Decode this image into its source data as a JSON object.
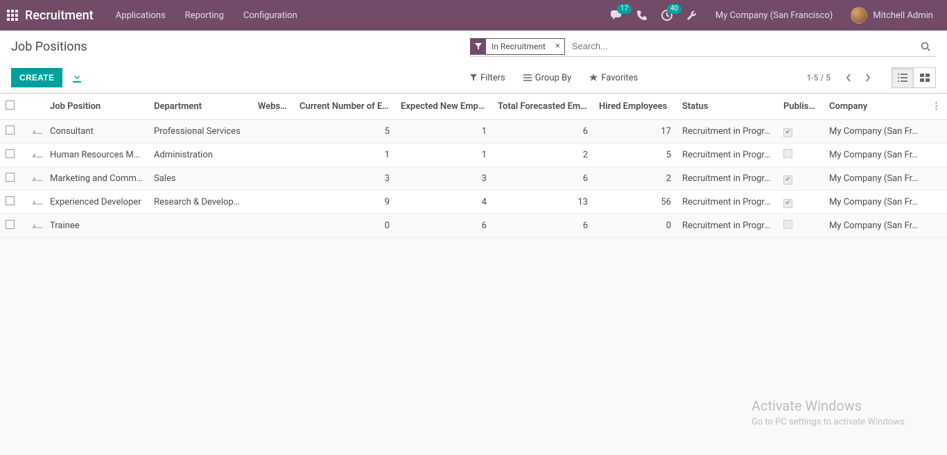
{
  "brand": "Recruitment",
  "nav": {
    "applications": "Applications",
    "reporting": "Reporting",
    "configuration": "Configuration"
  },
  "badges": {
    "chat": "17",
    "clock": "40"
  },
  "company": "My Company (San Francisco)",
  "user": "Mitchell Admin",
  "breadcrumb": "Job Positions",
  "search": {
    "facet_label": "In Recruitment",
    "placeholder": "Search..."
  },
  "opts": {
    "filters": "Filters",
    "groupby": "Group By",
    "favorites": "Favorites"
  },
  "create": "CREATE",
  "pager": "1-5 / 5",
  "cols": {
    "job": "Job Position",
    "dept": "Department",
    "website": "Website",
    "current": "Current Number of E…",
    "expected": "Expected New Empl…",
    "forecast": "Total Forecasted Em…",
    "hired": "Hired Employees",
    "status": "Status",
    "published": "Published",
    "company": "Company"
  },
  "rows": [
    {
      "job": "Consultant",
      "dept": "Professional Services",
      "web": "",
      "cur": "5",
      "exp": "1",
      "fc": "6",
      "hired": "17",
      "status": "Recruitment in Progre…",
      "pub": true,
      "co": "My Company (San Fr…"
    },
    {
      "job": "Human Resources Ma…",
      "dept": "Administration",
      "web": "",
      "cur": "1",
      "exp": "1",
      "fc": "2",
      "hired": "5",
      "status": "Recruitment in Progre…",
      "pub": false,
      "co": "My Company (San Fr…"
    },
    {
      "job": "Marketing and Comm…",
      "dept": "Sales",
      "web": "",
      "cur": "3",
      "exp": "3",
      "fc": "6",
      "hired": "2",
      "status": "Recruitment in Progre…",
      "pub": true,
      "co": "My Company (San Fr…"
    },
    {
      "job": "Experienced Developer",
      "dept": "Research & Developm…",
      "web": "",
      "cur": "9",
      "exp": "4",
      "fc": "13",
      "hired": "56",
      "status": "Recruitment in Progre…",
      "pub": true,
      "co": "My Company (San Fr…"
    },
    {
      "job": "Trainee",
      "dept": "",
      "web": "",
      "cur": "0",
      "exp": "6",
      "fc": "6",
      "hired": "0",
      "status": "Recruitment in Progre…",
      "pub": false,
      "co": "My Company (San Fr…"
    }
  ],
  "watermark": {
    "l1": "Activate Windows",
    "l2": "Go to PC settings to activate Windows."
  }
}
